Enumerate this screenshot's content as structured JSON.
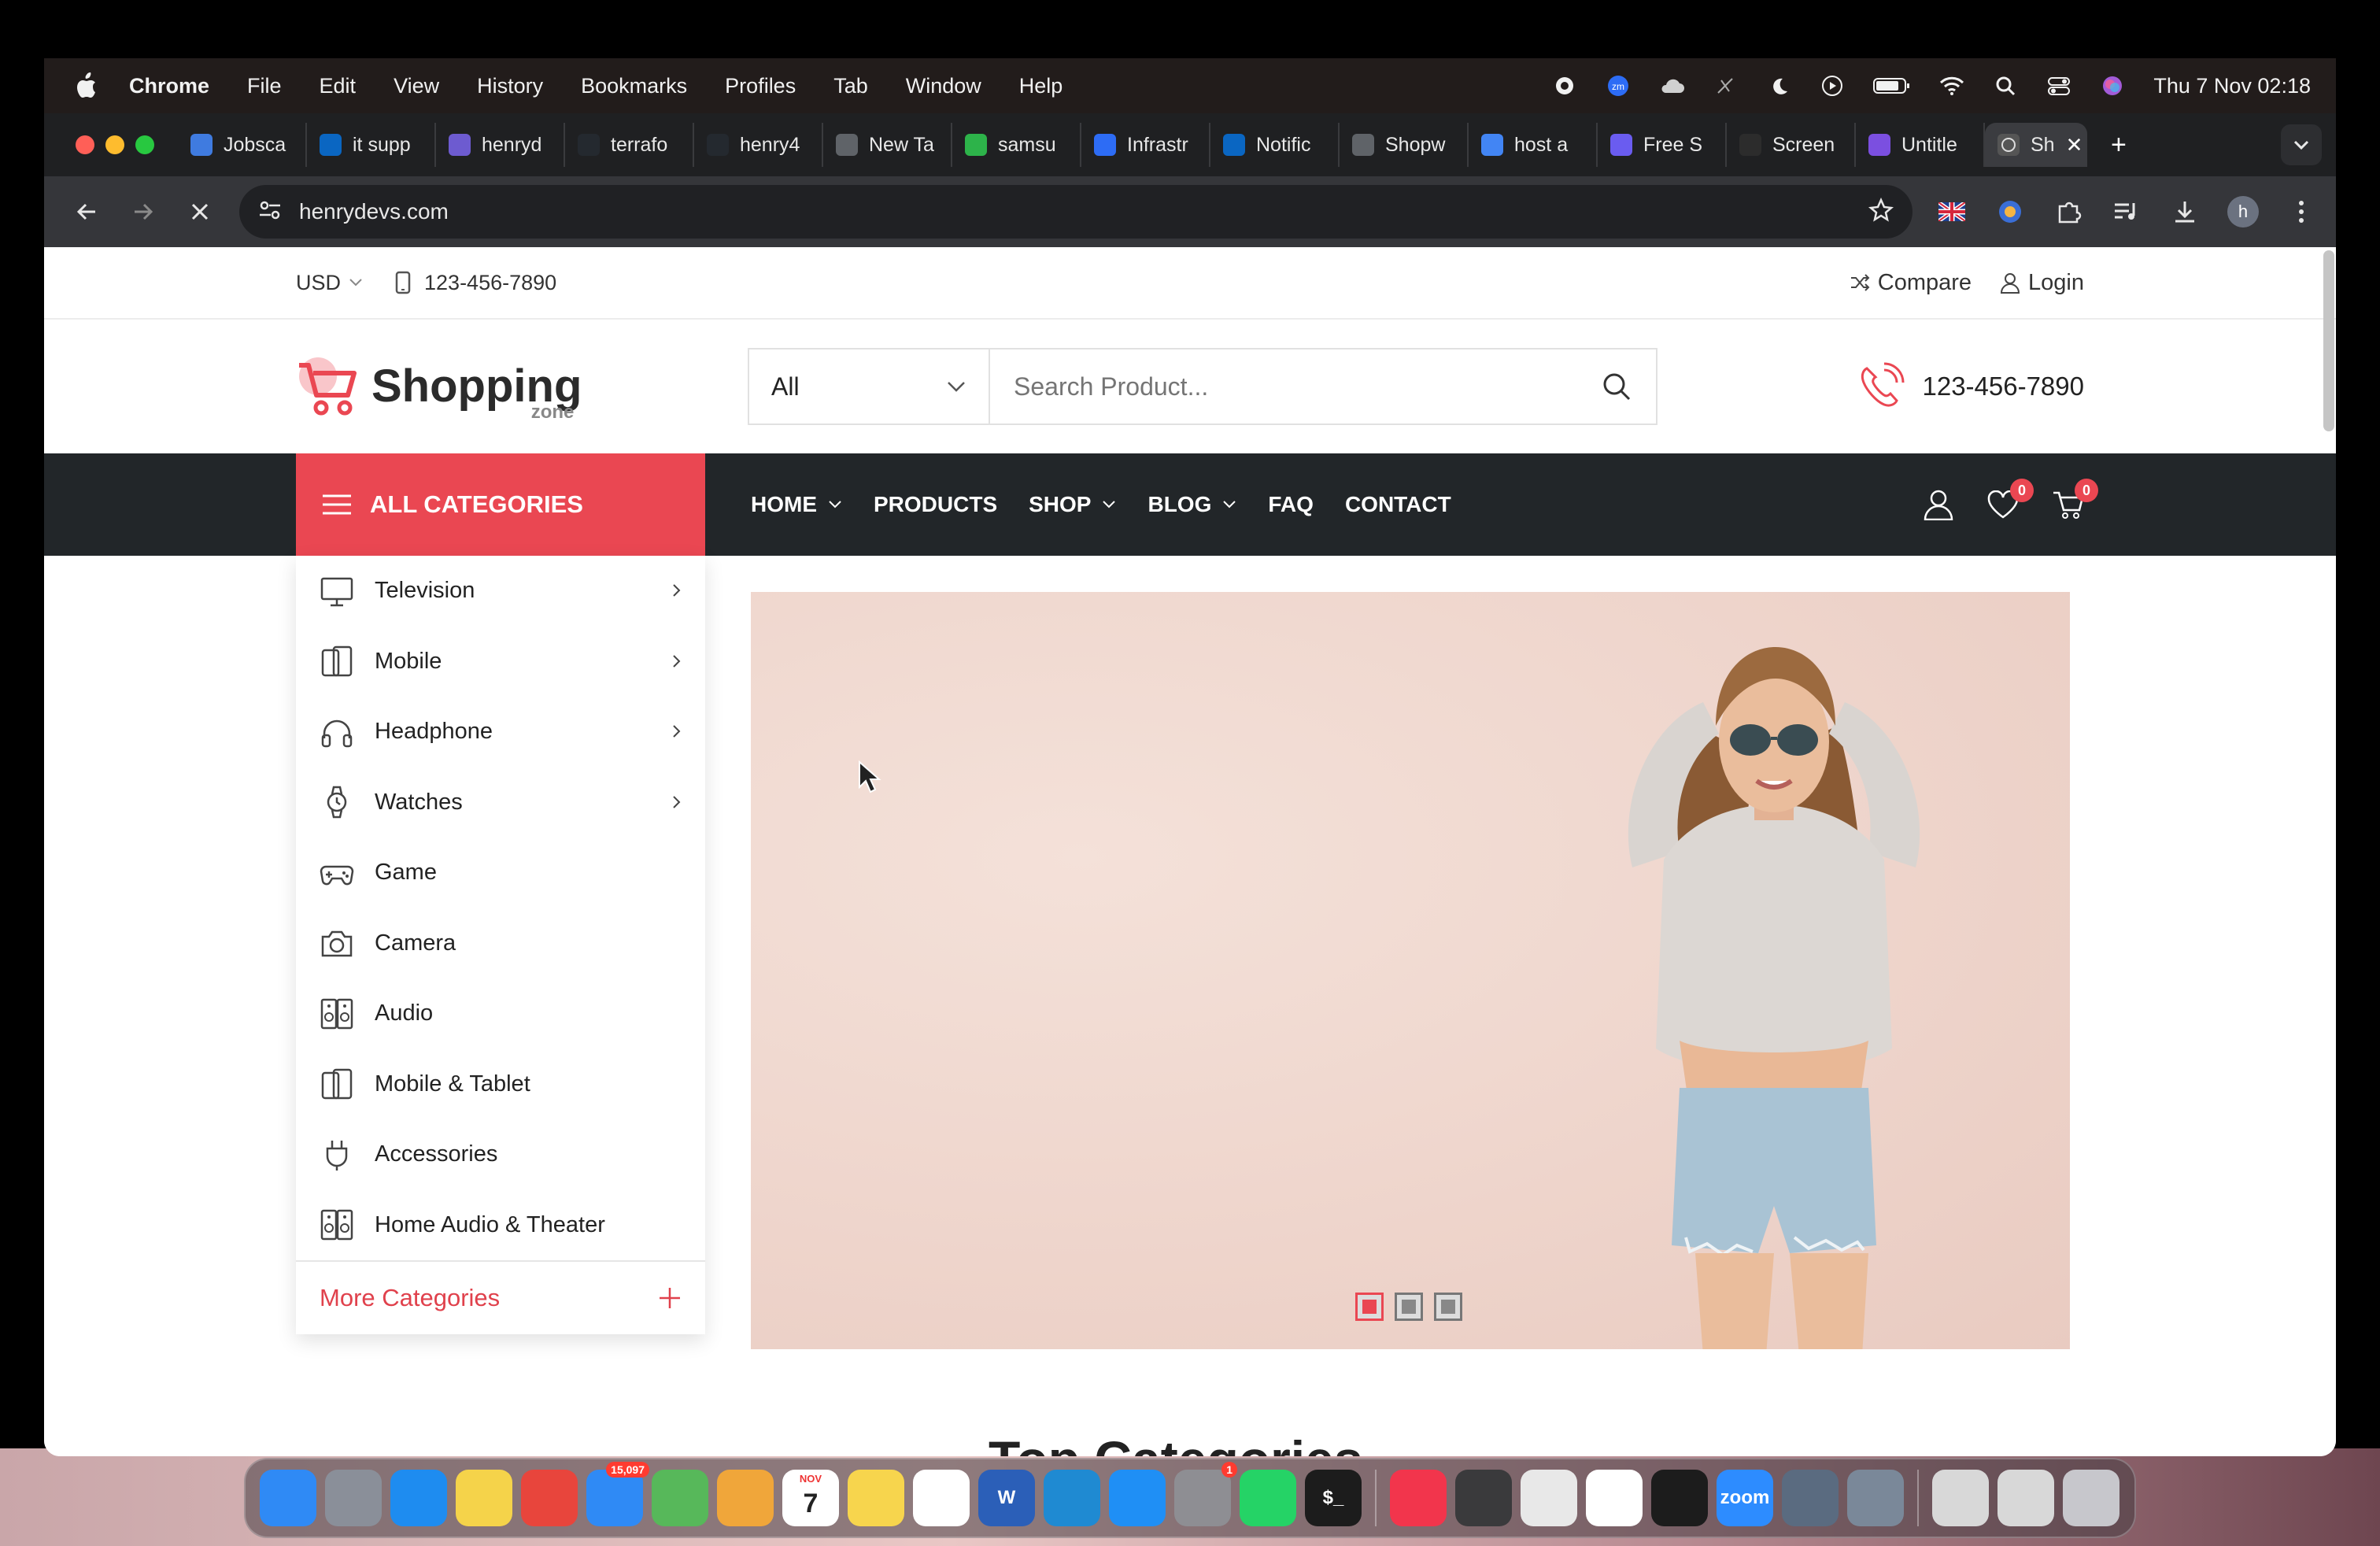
{
  "menubar": {
    "app_name": "Chrome",
    "items": [
      "File",
      "Edit",
      "View",
      "History",
      "Bookmarks",
      "Profiles",
      "Tab",
      "Window",
      "Help"
    ],
    "clock": "Thu 7 Nov  02:18"
  },
  "tabs": [
    {
      "title": "Jobsca",
      "color": "#3f7be0",
      "icon": "jobscan-icon"
    },
    {
      "title": "it supp",
      "color": "#0a66c2",
      "icon": "linkedin-icon"
    },
    {
      "title": "henryd",
      "color": "#6d5bd0",
      "icon": "henrydev-icon"
    },
    {
      "title": "terrafo",
      "color": "#24292f",
      "icon": "github-icon"
    },
    {
      "title": "henry4",
      "color": "#24292f",
      "icon": "github-icon"
    },
    {
      "title": "New Ta",
      "color": "#5f6368",
      "icon": "chrome-icon"
    },
    {
      "title": "samsu",
      "color": "#2db34a",
      "icon": "kaggle-icon"
    },
    {
      "title": "Infrastr",
      "color": "#2d6cf5",
      "icon": "zoom-icon"
    },
    {
      "title": "Notific",
      "color": "#0a66c2",
      "icon": "linkedin-icon"
    },
    {
      "title": "Shopw",
      "color": "#5f6368",
      "icon": "globe-icon"
    },
    {
      "title": "host a",
      "color": "#4285f4",
      "icon": "google-icon"
    },
    {
      "title": "Free S",
      "color": "#6a5cf0",
      "icon": "gear-icon"
    },
    {
      "title": "Screen",
      "color": "#2c2c2c",
      "icon": "screen-icon"
    },
    {
      "title": "Untitle",
      "color": "#7b4fe0",
      "icon": "video-icon"
    }
  ],
  "active_tab": {
    "title": "Sh",
    "close": "✕"
  },
  "new_tab_label": "+",
  "address": {
    "url": "henrydevs.com"
  },
  "site": {
    "topbar": {
      "currency": "USD",
      "phone": "123-456-7890",
      "compare": "Compare",
      "login": "Login"
    },
    "logo": {
      "brand": "Shopping",
      "sub": "zone"
    },
    "search": {
      "category": "All",
      "placeholder": "Search Product..."
    },
    "hotline": "123-456-7890",
    "all_categories": "ALL CATEGORIES",
    "nav": [
      {
        "label": "HOME",
        "dropdown": true
      },
      {
        "label": "PRODUCTS",
        "dropdown": false
      },
      {
        "label": "SHOP",
        "dropdown": true
      },
      {
        "label": "BLOG",
        "dropdown": true
      },
      {
        "label": "FAQ",
        "dropdown": false
      },
      {
        "label": "CONTACT",
        "dropdown": false
      }
    ],
    "wishlist_count": "0",
    "cart_count": "0",
    "categories": [
      {
        "label": "Television",
        "icon": "television-icon",
        "has_sub": true
      },
      {
        "label": "Mobile",
        "icon": "mobile-icon",
        "has_sub": true
      },
      {
        "label": "Headphone",
        "icon": "headphone-icon",
        "has_sub": true
      },
      {
        "label": "Watches",
        "icon": "watch-icon",
        "has_sub": true
      },
      {
        "label": "Game",
        "icon": "gamepad-icon",
        "has_sub": false
      },
      {
        "label": "Camera",
        "icon": "camera-icon",
        "has_sub": false
      },
      {
        "label": "Audio",
        "icon": "speaker-icon",
        "has_sub": false
      },
      {
        "label": "Mobile & Tablet",
        "icon": "tablet-icon",
        "has_sub": false
      },
      {
        "label": "Accessories",
        "icon": "plug-icon",
        "has_sub": false
      },
      {
        "label": "Home Audio & Theater",
        "icon": "speaker-icon",
        "has_sub": false
      }
    ],
    "more_categories": "More Categories",
    "section_title": "Top Categories",
    "slider_active": 1,
    "slider_count": 3
  },
  "colors": {
    "accent": "#ea4752",
    "nav_bg": "#222629",
    "hero_bg": "#efd6cd"
  },
  "dock": [
    {
      "name": "finder-icon",
      "color": "#2f8af5"
    },
    {
      "name": "launchpad-icon",
      "color": "#8a8f99"
    },
    {
      "name": "safari-icon",
      "color": "#1e8cf0"
    },
    {
      "name": "stickies-icon",
      "color": "#f5d34a"
    },
    {
      "name": "chrome-icon",
      "color": "#e8453c"
    },
    {
      "name": "mail-icon",
      "color": "#2f8af5",
      "badge": "15,097"
    },
    {
      "name": "maps-icon",
      "color": "#57b85a"
    },
    {
      "name": "photos-icon",
      "color": "#f0a63a"
    },
    {
      "name": "calendar-icon",
      "color": "#ffffff",
      "text": "7",
      "month": "NOV"
    },
    {
      "name": "notes-icon",
      "color": "#f7d54d"
    },
    {
      "name": "reminders-icon",
      "color": "#ffffff"
    },
    {
      "name": "word-icon",
      "color": "#2b5fb8",
      "text": "W"
    },
    {
      "name": "vscode-icon",
      "color": "#1f8ad2"
    },
    {
      "name": "appstore-icon",
      "color": "#1f8ff5"
    },
    {
      "name": "settings-icon",
      "color": "#8e8e93",
      "badge": "1"
    },
    {
      "name": "whatsapp-icon",
      "color": "#25d366"
    },
    {
      "name": "terminal-icon",
      "color": "#1c1c1c",
      "text": "$_"
    },
    {
      "name": "music-icon",
      "color": "#f2354c"
    },
    {
      "name": "calculator-icon",
      "color": "#3a3a3c"
    },
    {
      "name": "script-editor-icon",
      "color": "#e8e8e8"
    },
    {
      "name": "slack-icon",
      "color": "#ffffff"
    },
    {
      "name": "activity-monitor-icon",
      "color": "#1c1c1c"
    },
    {
      "name": "zoom-icon",
      "color": "#2d8cff",
      "text": "zoom"
    },
    {
      "name": "quicktime-icon",
      "color": "#5a6b80"
    },
    {
      "name": "preview-icon",
      "color": "#7a8899"
    },
    {
      "name": "screenshot-folder-icon",
      "color": "#d8d8d8"
    },
    {
      "name": "screenshot-folder-icon-2",
      "color": "#d8d8d8"
    },
    {
      "name": "trash-icon",
      "color": "#c7c7cc"
    }
  ]
}
